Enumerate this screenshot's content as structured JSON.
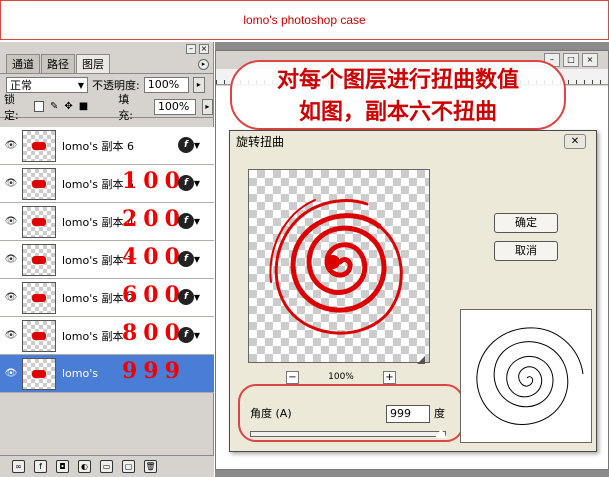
{
  "banner": {
    "title": "lomo's photoshop case"
  },
  "layers_panel": {
    "tabs": [
      "通道",
      "路径",
      "图层"
    ],
    "active_tab": "图层",
    "blend_mode": "正常",
    "opacity_label": "不透明度:",
    "opacity_value": "100%",
    "lock_label": "锁定:",
    "fill_label": "填充:",
    "fill_value": "100%",
    "layers": [
      {
        "name": "lomo's 副本 6",
        "value": "",
        "selected": false
      },
      {
        "name": "lomo's 副本 5",
        "value": "100",
        "selected": false
      },
      {
        "name": "lomo's 副本 4",
        "value": "200",
        "selected": false
      },
      {
        "name": "lomo's 副本 3",
        "value": "400",
        "selected": false
      },
      {
        "name": "lomo's 副本 2",
        "value": "600",
        "selected": false
      },
      {
        "name": "lomo's 副本",
        "value": "800",
        "selected": false
      },
      {
        "name": "lomo's",
        "value": "999",
        "selected": true
      }
    ]
  },
  "annotation": {
    "line1": "对每个图层进行扭曲数值",
    "line2": "如图，副本六不扭曲"
  },
  "dialog": {
    "title": "旋转扭曲",
    "ok_label": "确定",
    "cancel_label": "取消",
    "zoom_value": "100%",
    "angle_label": "角度 (A)",
    "angle_value": "999",
    "angle_unit": "度"
  },
  "colors": {
    "accent_red": "#e00000",
    "selection_blue": "#4a7ed6"
  }
}
